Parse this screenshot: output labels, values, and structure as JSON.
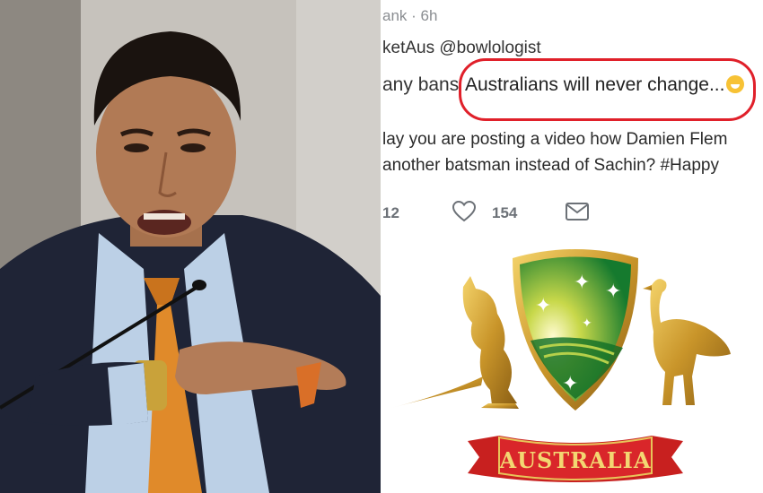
{
  "tweet": {
    "meta": "ank · 6h",
    "handle": "ketAus @bowlologist",
    "quote_prefix": "any bans",
    "quote_highlight": "Australians will never change...",
    "body_line_1": "lay you are posting a video how Damien Flem",
    "body_line_2": "another batsman instead of Sachin? #Happy",
    "reply_count": "12",
    "like_count": "154",
    "icons": [
      "heart-icon",
      "mail-icon"
    ]
  },
  "emblem": {
    "banner_text": "AUSTRALIA"
  },
  "colors": {
    "highlight_ring": "#e0202a",
    "shield_green": "#1f9a3a",
    "gold": "#d6a93a",
    "banner_red": "#c8201f"
  }
}
